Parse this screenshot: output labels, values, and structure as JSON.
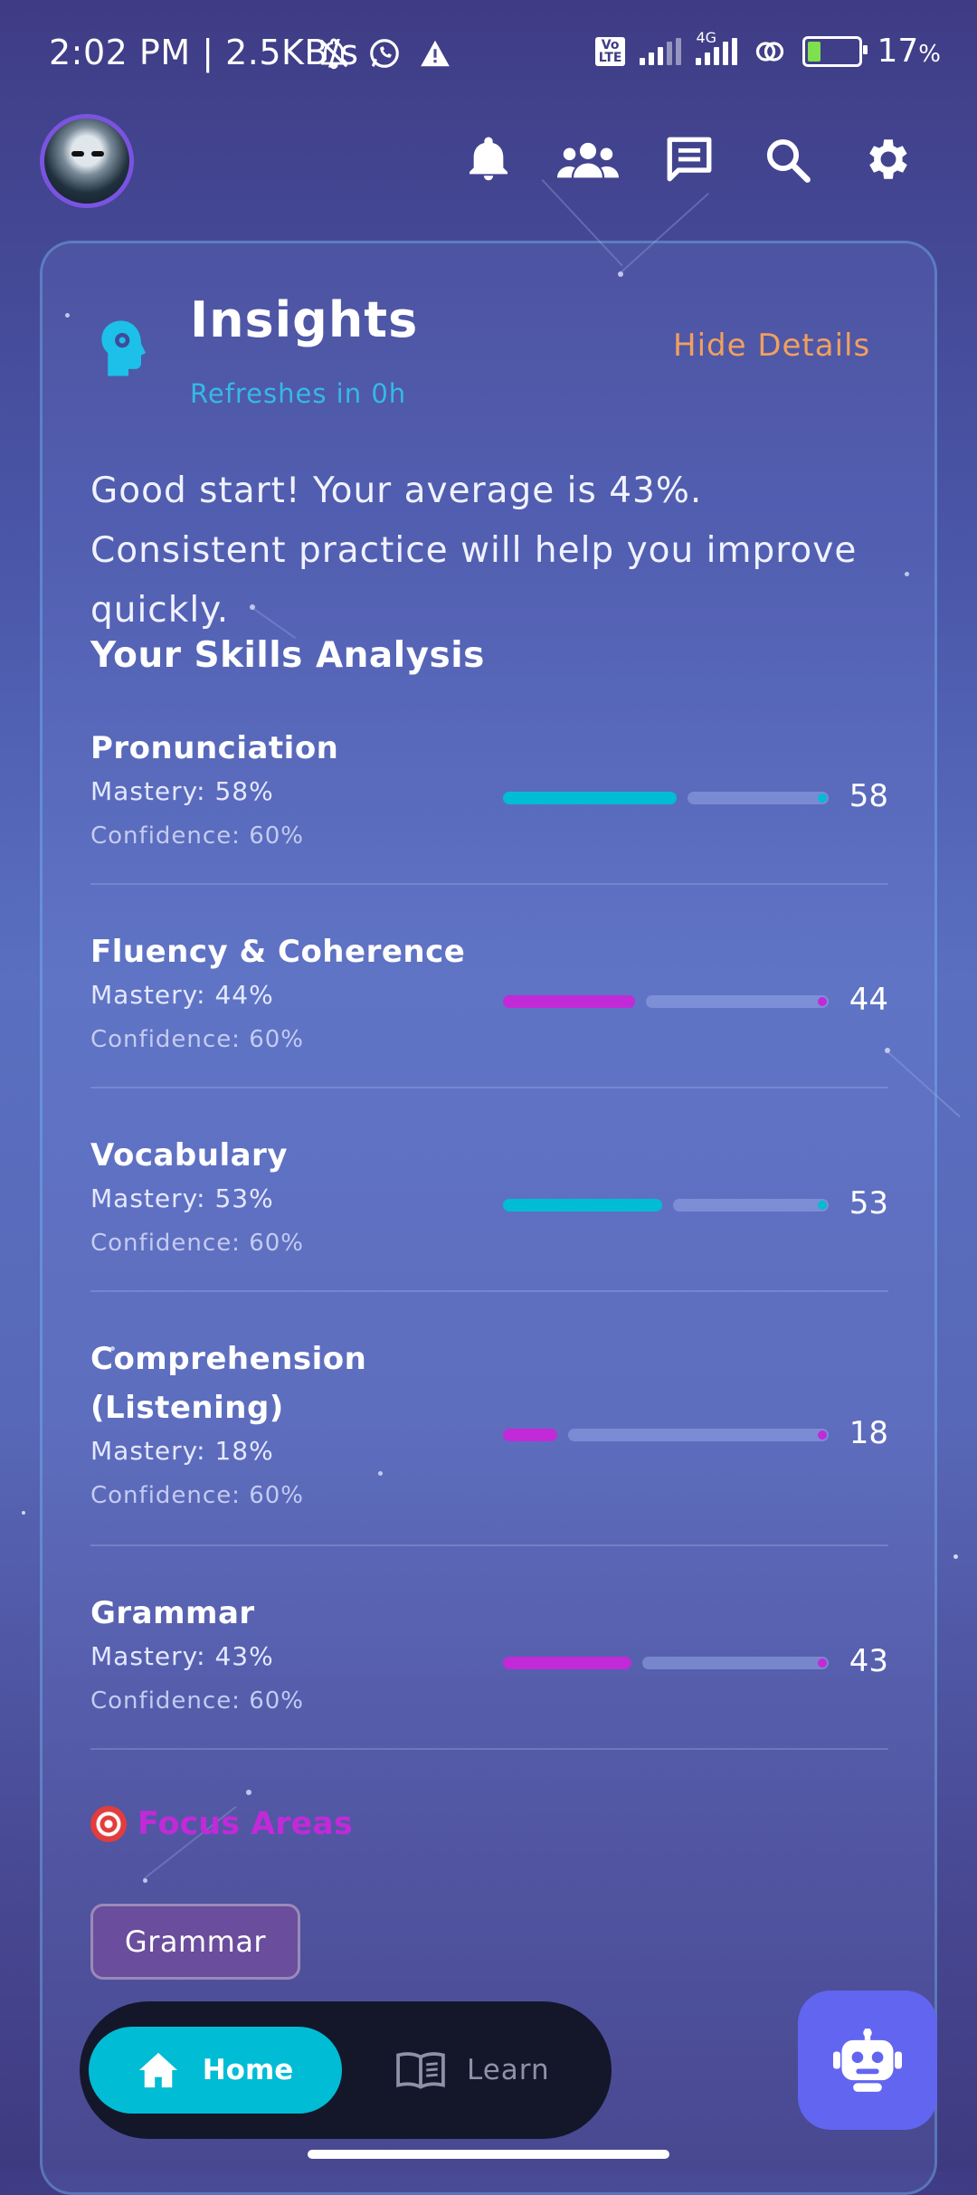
{
  "status_bar": {
    "time": "2:02 PM | 2.5KB/s",
    "network_label": "4G",
    "battery": "17",
    "battery_unit": "%"
  },
  "header": {
    "icons": [
      "bell-icon",
      "group-icon",
      "chat-icon",
      "search-icon",
      "gear-icon"
    ]
  },
  "insights": {
    "title": "Insights",
    "subtitle": "Refreshes in 0h",
    "hide_details": "Hide Details",
    "summary": "Good start! Your average is 43%. Consistent practice will help you improve quickly.",
    "section_title": "Your Skills Analysis"
  },
  "skills": [
    {
      "name": "Pronunciation",
      "mastery": "Mastery: 58%",
      "confidence": "Confidence: 60%",
      "value": "58",
      "color": "#00bcd4"
    },
    {
      "name": "Fluency & Coherence",
      "mastery": "Mastery: 44%",
      "confidence": "Confidence: 60%",
      "value": "44",
      "color": "#c22ad8"
    },
    {
      "name": "Vocabulary",
      "mastery": "Mastery: 53%",
      "confidence": "Confidence: 60%",
      "value": "53",
      "color": "#00bcd4"
    },
    {
      "name": "Comprehension (Listening)",
      "mastery": "Mastery: 18%",
      "confidence": "Confidence: 60%",
      "value": "18",
      "color": "#c22ad8"
    },
    {
      "name": "Grammar",
      "mastery": "Mastery: 43%",
      "confidence": "Confidence: 60%",
      "value": "43",
      "color": "#c22ad8"
    }
  ],
  "focus": {
    "title": "Focus Areas",
    "chips": [
      "Grammar"
    ]
  },
  "nav": {
    "home": "Home",
    "learn": "Learn"
  },
  "colors": {
    "accent_cyan": "#00bcd4",
    "accent_magenta": "#c22ad8",
    "hide_details": "#f0a060",
    "bot_button": "#6265f0"
  }
}
